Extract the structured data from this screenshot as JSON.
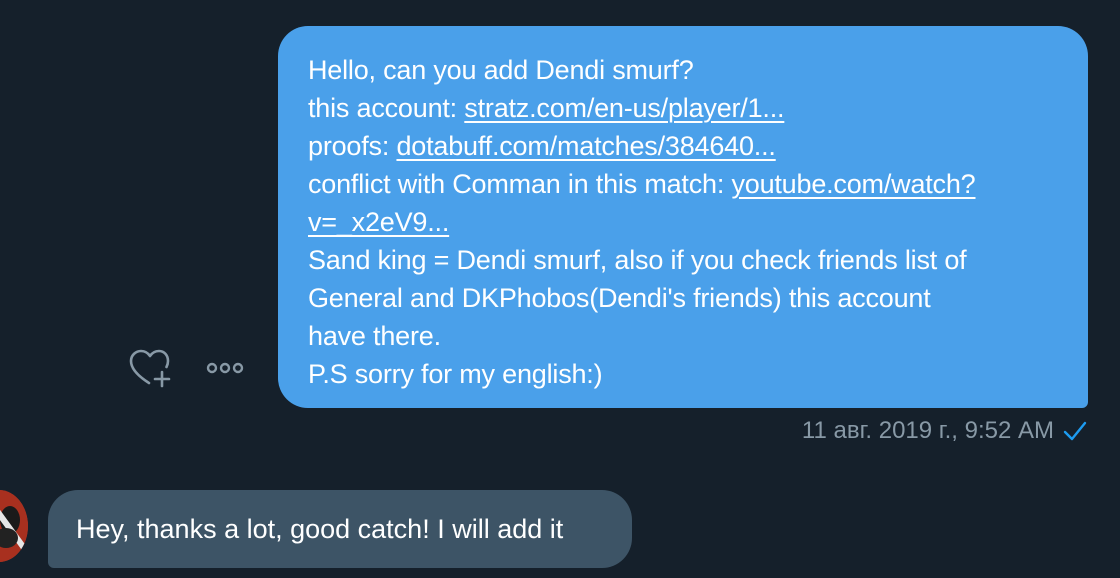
{
  "sent_message": {
    "line1": "Hello, can you add Dendi smurf?",
    "line2_prefix": "this account: ",
    "line2_link": "stratz.com/en-us/player/1...",
    "line3_prefix": "proofs: ",
    "line3_link": "dotabuff.com/matches/384640...",
    "line4_prefix": "conflict with Comman in this match: ",
    "line4_link_part1": "youtube.com/watch?",
    "line5_link_part2": "v=_x2eV9...",
    "line6": "Sand king = Dendi smurf, also if you check friends list of",
    "line7": "General and DKPhobos(Dendi's friends) this account",
    "line8": "have there.",
    "line9": "P.S sorry for my english:)",
    "timestamp": "11 авг. 2019 г., 9:52 AM"
  },
  "received_message": {
    "text": "Hey, thanks a lot, good catch! I will add it"
  },
  "colors": {
    "background": "#15202b",
    "sent_bubble": "#4aa0ea",
    "received_bubble": "#3d5466",
    "muted_text": "#8899a6",
    "read_check": "#1d9bf0"
  },
  "icons": {
    "react": "heart-plus-icon",
    "more": "more-dots-icon",
    "read_receipt": "checkmark-icon"
  }
}
